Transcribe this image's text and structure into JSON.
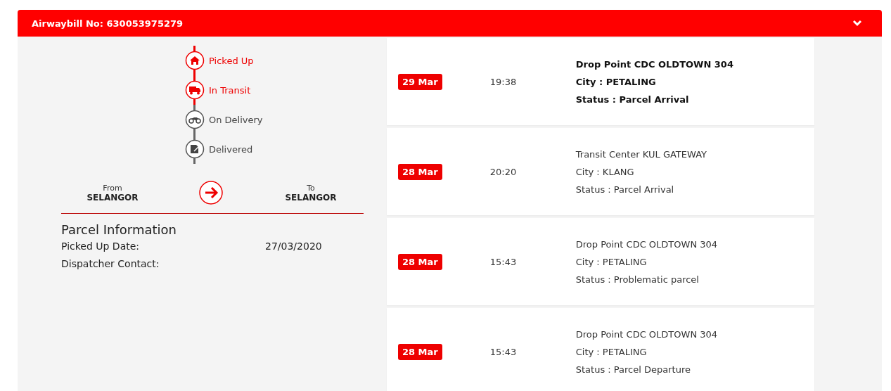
{
  "header": {
    "title": "Airwaybill No: 630053975279",
    "expanded": true
  },
  "steps": [
    {
      "label": "Picked Up",
      "kind": "home",
      "done": true
    },
    {
      "label": "In Transit",
      "kind": "truck",
      "done": true
    },
    {
      "label": "On Delivery",
      "kind": "motorbike",
      "done": false
    },
    {
      "label": "Delivered",
      "kind": "signed",
      "done": false
    }
  ],
  "route": {
    "from_label": "From",
    "from": "SELANGOR",
    "to_label": "To",
    "to": "SELANGOR"
  },
  "parcel_info": {
    "title": "Parcel Information",
    "fields": [
      {
        "label": "Picked Up Date:",
        "value": "27/03/2020"
      },
      {
        "label": "Dispatcher Contact:"
      }
    ]
  },
  "events": [
    {
      "date": "29 Mar",
      "time": "19:38",
      "location": "Drop Point CDC OLDTOWN 304",
      "city": "City : PETALING",
      "status": "Status : Parcel Arrival",
      "latest": true
    },
    {
      "date": "28 Mar",
      "time": "20:20",
      "location": "Transit Center KUL GATEWAY",
      "city": "City : KLANG",
      "status": "Status : Parcel Arrival",
      "latest": false
    },
    {
      "date": "28 Mar",
      "time": "15:43",
      "location": "Drop Point CDC OLDTOWN 304",
      "city": "City : PETALING",
      "status": "Status : Problematic parcel",
      "latest": false
    },
    {
      "date": "28 Mar",
      "time": "15:43",
      "location": "Drop Point CDC OLDTOWN 304",
      "city": "City : PETALING",
      "status": "Status : Parcel Departure",
      "latest": false
    }
  ]
}
